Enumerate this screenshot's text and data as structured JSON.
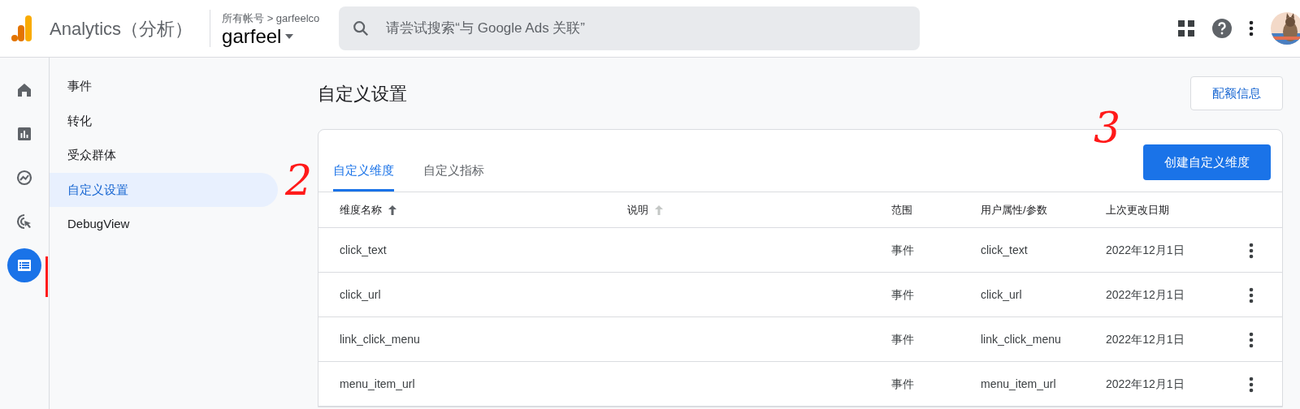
{
  "header": {
    "product": "Analytics（分析）",
    "breadcrumb": "所有帐号 > garfeelco",
    "account": "garfeel",
    "search": {
      "placeholder": "请尝试搜索“与 Google Ads 关联”"
    }
  },
  "rail": [
    {
      "kind": "home",
      "selected": false
    },
    {
      "kind": "reports",
      "selected": false
    },
    {
      "kind": "explore",
      "selected": false
    },
    {
      "kind": "advertising",
      "selected": false
    },
    {
      "kind": "configure",
      "selected": true
    }
  ],
  "sidebar": {
    "items": [
      {
        "label": "事件",
        "selected": false
      },
      {
        "label": "转化",
        "selected": false
      },
      {
        "label": "受众群体",
        "selected": false
      },
      {
        "label": "自定义设置",
        "selected": true
      },
      {
        "label": "DebugView",
        "selected": false
      }
    ]
  },
  "page_title": "自定义设置",
  "quota_button": "配额信息",
  "tabs": [
    {
      "label": "自定义维度",
      "selected": true
    },
    {
      "label": "自定义指标",
      "selected": false
    }
  ],
  "create_button": "创建自定义维度",
  "table": {
    "columns": [
      {
        "label": "维度名称",
        "sorted": true
      },
      {
        "label": "说明",
        "sorted": false
      },
      {
        "label": "范围"
      },
      {
        "label": "用户属性/参数"
      },
      {
        "label": "上次更改日期"
      }
    ],
    "rows": [
      {
        "name": "click_text",
        "scope": "事件",
        "parameter": "click_text",
        "date": "2022年12月1日"
      },
      {
        "name": "click_url",
        "scope": "事件",
        "parameter": "click_url",
        "date": "2022年12月1日"
      },
      {
        "name": "link_click_menu",
        "scope": "事件",
        "parameter": "link_click_menu",
        "date": "2022年12月1日"
      },
      {
        "name": "menu_item_url",
        "scope": "事件",
        "parameter": "menu_item_url",
        "date": "2022年12月1日"
      }
    ]
  },
  "annotations": [
    {
      "kind": "number",
      "text": "2"
    },
    {
      "kind": "number",
      "text": "3"
    },
    {
      "kind": "line"
    }
  ]
}
